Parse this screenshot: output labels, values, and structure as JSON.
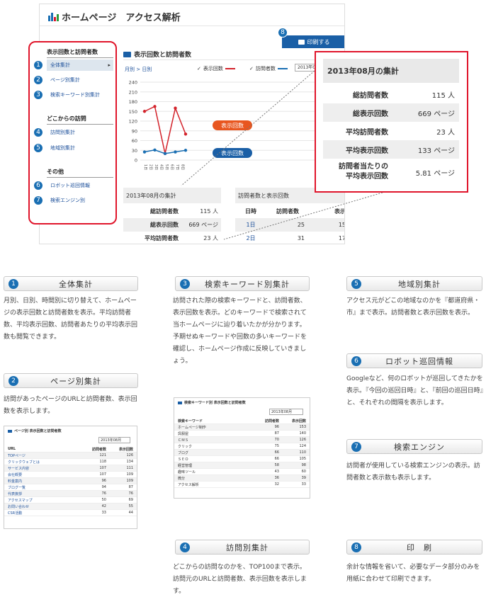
{
  "screenshot": {
    "app_title": "ホームページ　アクセス解析",
    "print_label": "印刷する",
    "print_num": "8",
    "sidebar": {
      "head1": "表示回数と訪問者数",
      "items1": [
        {
          "num": "1",
          "label": "全体集計",
          "arrow": "▸"
        },
        {
          "num": "2",
          "label": "ページ別集計"
        },
        {
          "num": "3",
          "label": "検索キーワード別集計"
        }
      ],
      "head2": "どこからの訪問",
      "items2": [
        {
          "num": "4",
          "label": "訪問別集計"
        },
        {
          "num": "5",
          "label": "地域別集計"
        }
      ],
      "head3": "その他",
      "items3": [
        {
          "num": "6",
          "label": "ロボット巡回情報"
        },
        {
          "num": "7",
          "label": "検索エンジン別"
        }
      ]
    },
    "chart_section": {
      "title": "表示回数と訪問者数",
      "breadcrumb": "月別 > 日別",
      "legend_pv": "表示回数",
      "legend_uv": "訪問者数",
      "date_select": "2013年08"
    },
    "left_table": {
      "title": "2013年08月の集計",
      "rows": [
        {
          "label": "総訪問者数",
          "value": "115 人"
        },
        {
          "label": "総表示回数",
          "value": "669 ページ"
        },
        {
          "label": "平均訪問者数",
          "value": "23 人"
        }
      ]
    },
    "right_table": {
      "title": "訪問者数と表示回数",
      "headers": [
        "日時",
        "訪問者数",
        "表示"
      ],
      "rows": [
        [
          "1日",
          "25",
          "15"
        ],
        [
          "2日",
          "31",
          "17"
        ]
      ]
    }
  },
  "chart_data": {
    "type": "line",
    "x": [
      1,
      2,
      3,
      4,
      5,
      6
    ],
    "series": [
      {
        "name": "表示回数",
        "values": [
          150,
          165,
          20,
          160,
          80,
          null
        ],
        "color": "#d3232b"
      },
      {
        "name": "訪問者数",
        "values": [
          25,
          31,
          20,
          25,
          30,
          null
        ],
        "color": "#1a6fb3"
      }
    ],
    "ylim": [
      0,
      240
    ],
    "yticks": [
      "240",
      "210",
      "180",
      "150",
      "120",
      "90",
      "60",
      "30",
      "0"
    ],
    "xticks": [
      "1日",
      "2日",
      "3日",
      "4日",
      "5日",
      "6日",
      "7日",
      "8日"
    ],
    "badge_pv": "表示回数",
    "badge_uv": "表示回数"
  },
  "callout": {
    "title": "2013年08月の集計",
    "rows": [
      {
        "label": "総訪問者数",
        "value": "115 人"
      },
      {
        "label": "総表示回数",
        "value": "669 ページ"
      },
      {
        "label": "平均訪問者数",
        "value": "23 人"
      },
      {
        "label": "平均表示回数",
        "value": "133 ページ"
      },
      {
        "label": "訪問者当たりの\n平均表示回数",
        "value": "5.81 ページ"
      }
    ]
  },
  "features": {
    "f1": {
      "num": "1",
      "title": "全体集計",
      "desc": "月別、日別、時間別に切り替えて、ホームページの表示回数と訪問者数を表示。平均訪問者数、平均表示回数、訪問者あたりの平均表示回数も閲覧できます。"
    },
    "f2": {
      "num": "2",
      "title": "ページ別集計",
      "desc": "訪問があったページのURLと訪問者数、表示回数を表示します。"
    },
    "f3": {
      "num": "3",
      "title": "検索キーワード別集計",
      "desc": "訪問された際の検索キーワードと、訪問者数、表示回数を表示。どのキーワードで検索されて当ホームページに辿り着いたかが分かります。予期せぬキーワードや回数の多いキーワードを確認し、ホームページ作成に反映していきましょう。"
    },
    "f4": {
      "num": "4",
      "title": "訪問別集計",
      "desc": "どこからの訪問なのかを、TOP100まで表示。訪問元のURLと訪問者数、表示回数を表示します。"
    },
    "f5": {
      "num": "5",
      "title": "地域別集計",
      "desc": "アクセス元がどこの地域なのかを『都道府県・市』まで表示。訪問者数と表示回数を表示。"
    },
    "f6": {
      "num": "6",
      "title": "ロボット巡回情報",
      "desc": "Googleなど、何のロボットが巡回してきたかを表示。『今回の巡回日時』と、『前回の巡回日時』と、それぞれの間隔を表示します。"
    },
    "f7": {
      "num": "7",
      "title": "検索エンジン",
      "desc": "訪問者が使用している検索エンジンの表示。訪問者数と表示数も表示します。"
    },
    "f8": {
      "num": "8",
      "title": "印　刷",
      "desc": "余計な情報を省いて、必要なデータ部分のみを用紙に合わせて印刷できます。"
    }
  },
  "mini_page": {
    "title": "ページ別 表示回数と訪問者数",
    "select": "2013年08月",
    "headers": [
      "URL",
      "訪問者数",
      "表示回数"
    ],
    "rows": [
      [
        "TOPページ",
        "121",
        "126"
      ],
      [
        "クリックウェブとは",
        "118",
        "134"
      ],
      [
        "サービス内容",
        "107",
        "111"
      ],
      [
        "会社概要",
        "107",
        "109"
      ],
      [
        "料金案内",
        "96",
        "109"
      ],
      [
        "ブログ一覧",
        "94",
        "87"
      ],
      [
        "代表挨拶",
        "76",
        "76"
      ],
      [
        "アクセスマップ",
        "50",
        "69"
      ],
      [
        "お問い合わせ",
        "42",
        "55"
      ],
      [
        "CSR活動",
        "33",
        "44"
      ]
    ]
  },
  "mini_kw": {
    "title": "検索キーワード別 表示回数と訪問者数",
    "select": "2013年08月",
    "headers": [
      "検索キーワード",
      "訪問者数",
      "表示回数"
    ],
    "rows": [
      [
        "ホームページ制作",
        "96",
        "153"
      ],
      [
        "呉服屋",
        "87",
        "140"
      ],
      [
        "ＣＭＳ",
        "70",
        "126"
      ],
      [
        "クリック",
        "75",
        "124"
      ],
      [
        "ブログ",
        "66",
        "110"
      ],
      [
        "ＳＥＯ",
        "66",
        "105"
      ],
      [
        "経営管理",
        "58",
        "98"
      ],
      [
        "趣味ツール",
        "43",
        "60"
      ],
      [
        "微分",
        "36",
        "39"
      ],
      [
        "アクセス解析",
        "32",
        "33"
      ]
    ]
  }
}
